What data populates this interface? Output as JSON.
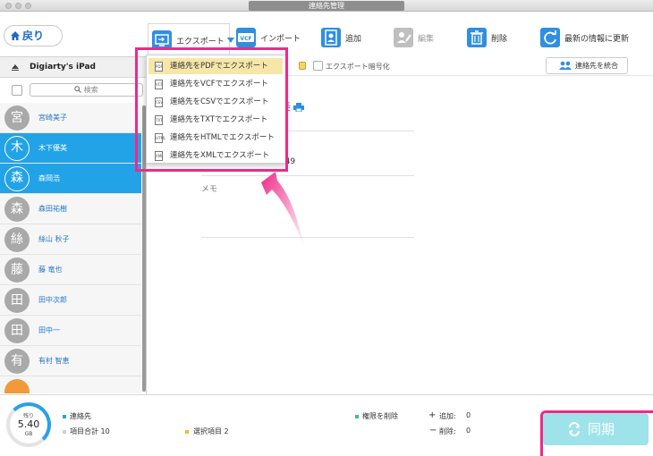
{
  "window": {
    "title": "連絡先管理"
  },
  "toolbar": {
    "back_label": "戻り",
    "export_label": "エクスポート",
    "import_label": "インポート",
    "add_label": "追加",
    "edit_label": "編集",
    "delete_label": "削除",
    "refresh_label": "最新の情報に更新"
  },
  "device": {
    "name": "Digiarty's iPad"
  },
  "search": {
    "placeholder": "検索"
  },
  "contacts": [
    {
      "initial": "宮",
      "name": "宮崎美子",
      "selected": false
    },
    {
      "initial": "木",
      "name": "木下優美",
      "selected": true
    },
    {
      "initial": "森",
      "name": "森岡浩",
      "selected": true
    },
    {
      "initial": "森",
      "name": "森田祐樹",
      "selected": false
    },
    {
      "initial": "絲",
      "name": "絲山 秋子",
      "selected": false
    },
    {
      "initial": "藤",
      "name": "藤 竜也",
      "selected": false
    },
    {
      "initial": "田",
      "name": "田中次郎",
      "selected": false
    },
    {
      "initial": "田",
      "name": "田中一",
      "selected": false
    },
    {
      "initial": "有",
      "name": "有村 智恵",
      "selected": false
    }
  ],
  "header_strip": {
    "encrypt_label": "エクスポート暗号化",
    "merge_label": "連絡先を統合"
  },
  "detail": {
    "name_tail": "美",
    "phone_label": "",
    "phone_value": "6362949",
    "memo_label": "メモ"
  },
  "export_menu": {
    "items": [
      {
        "icon": "PDF",
        "label": "連絡先をPDFでエクスポート",
        "highlighted": true
      },
      {
        "icon": "VCF",
        "label": "連絡先をVCFでエクスポート",
        "highlighted": false
      },
      {
        "icon": "CSV",
        "label": "連絡先をCSVでエクスポート",
        "highlighted": false
      },
      {
        "icon": "TXT",
        "label": "連絡先をTXTでエクスポート",
        "highlighted": false
      },
      {
        "icon": "HTML",
        "label": "連絡先をHTMLでエクスポート",
        "highlighted": false
      },
      {
        "icon": "XML",
        "label": "連絡先をXMLでエクスポート",
        "highlighted": false
      }
    ]
  },
  "footer": {
    "storage_remaining_label": "残り",
    "storage_size": "5.40",
    "storage_unit": "GB",
    "legend_contacts": "連絡先",
    "legend_total": "項目合計 10",
    "legend_selected": "選択項目 2",
    "legend_delete_perm": "権限を削除",
    "add_label": "追加:",
    "add_value": "0",
    "remove_label": "削除:",
    "remove_value": "0",
    "sync_label": "同期"
  },
  "colors": {
    "accent": "#22a3e8",
    "highlight": "#ee2a88",
    "menu_highlight": "#f6e6a8",
    "sync_button": "#9fe3ea"
  }
}
